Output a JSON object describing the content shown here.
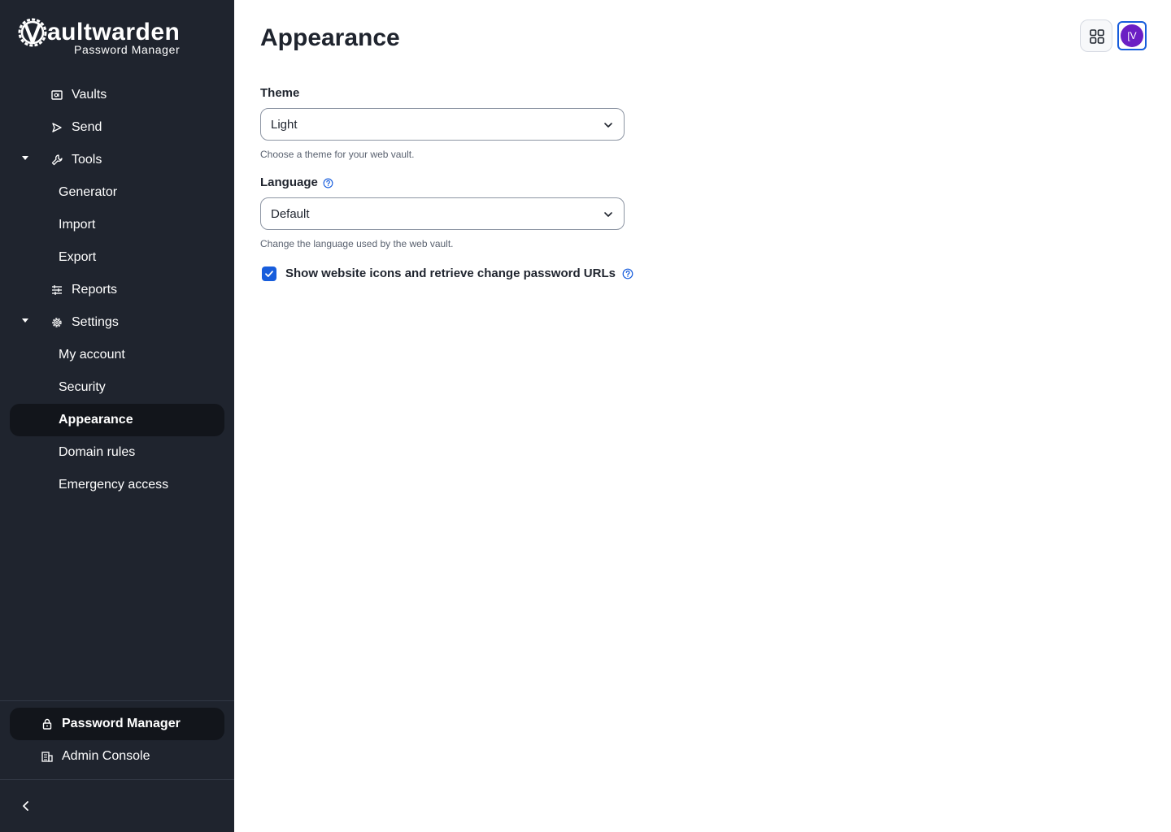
{
  "brand": {
    "name_bold": "aultwarden",
    "subtitle": "Password Manager"
  },
  "sidebar": {
    "items": [
      {
        "label": "Vaults",
        "icon": "vault-icon"
      },
      {
        "label": "Send",
        "icon": "send-icon"
      },
      {
        "label": "Tools",
        "icon": "wrench-icon",
        "expanded": true
      },
      {
        "label": "Generator"
      },
      {
        "label": "Import"
      },
      {
        "label": "Export"
      },
      {
        "label": "Reports",
        "icon": "sliders-icon"
      },
      {
        "label": "Settings",
        "icon": "gear-icon",
        "expanded": true
      },
      {
        "label": "My account"
      },
      {
        "label": "Security"
      },
      {
        "label": "Appearance",
        "active": true
      },
      {
        "label": "Domain rules"
      },
      {
        "label": "Emergency access"
      }
    ],
    "bottom": [
      {
        "label": "Password Manager",
        "icon": "lock-icon",
        "active": true
      },
      {
        "label": "Admin Console",
        "icon": "building-icon"
      }
    ]
  },
  "header": {
    "title": "Appearance",
    "avatar_initials": "[V"
  },
  "form": {
    "theme": {
      "label": "Theme",
      "value": "Light",
      "hint": "Choose a theme for your web vault."
    },
    "language": {
      "label": "Language",
      "value": "Default",
      "hint": "Change the language used by the web vault."
    },
    "website_icons": {
      "label": "Show website icons and retrieve change password URLs",
      "checked": true
    }
  },
  "colors": {
    "sidebar_bg": "#1f242e",
    "active_bg": "#12151b",
    "accent": "#175ddc",
    "avatar_bg": "#6b1fc4"
  }
}
